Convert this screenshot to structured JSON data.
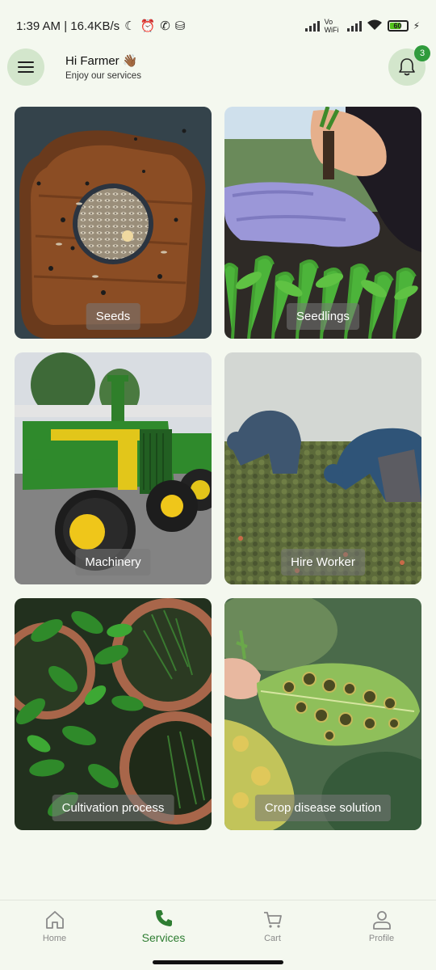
{
  "status_bar": {
    "time_speed": "1:39 AM | 16.4KB/s",
    "network_label": "Vo WiFi",
    "battery": "60"
  },
  "header": {
    "greeting": "Hi Farmer 👋🏾",
    "subtitle": "Enjoy our services",
    "notification_count": "3"
  },
  "services": [
    {
      "label": "Seeds"
    },
    {
      "label": "Seedlings"
    },
    {
      "label": "Machinery"
    },
    {
      "label": "Hire Worker"
    },
    {
      "label": "Cultivation process"
    },
    {
      "label": "Crop disease solution"
    }
  ],
  "bottom_nav": {
    "items": [
      {
        "label": "Home",
        "icon": "home-icon"
      },
      {
        "label": "Services",
        "icon": "phone-icon"
      },
      {
        "label": "Cart",
        "icon": "cart-icon"
      },
      {
        "label": "Profile",
        "icon": "profile-icon"
      }
    ],
    "active": "Services"
  },
  "colors": {
    "background": "#f4f8ef",
    "accent_green": "#2e7d32",
    "badge_green": "#2f9b3c",
    "button_bg": "#d3e6cc"
  }
}
